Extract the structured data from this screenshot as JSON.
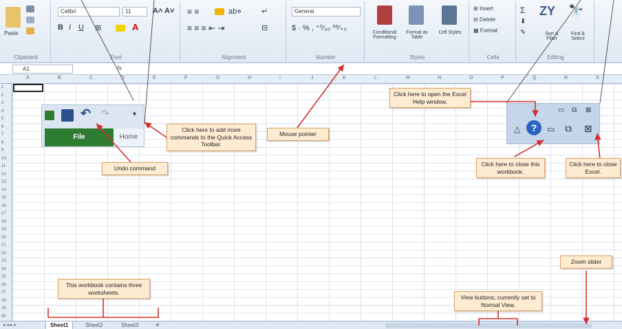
{
  "ribbon": {
    "clipboard": {
      "label": "Clipboard",
      "paste": "Paste"
    },
    "font": {
      "label": "Font",
      "font_name": "Calibri",
      "font_size": "11"
    },
    "alignment": {
      "label": "Alignment"
    },
    "number": {
      "label": "Number",
      "format": "General"
    },
    "styles": {
      "label": "Styles",
      "conditional": "Conditional Formatting",
      "format_table": "Format as Table",
      "cell_styles": "Cell Styles"
    },
    "cells": {
      "label": "Cells",
      "insert": "Insert",
      "delete": "Delete",
      "format": "Format"
    },
    "editing": {
      "label": "Editing",
      "sort": "Sort & Filter",
      "find": "Find & Select"
    }
  },
  "formula_bar": {
    "name_box": "A1",
    "fx": "fx"
  },
  "columns": [
    "A",
    "B",
    "C",
    "D",
    "E",
    "F",
    "G",
    "H",
    "I",
    "J",
    "K",
    "L",
    "M",
    "N",
    "O",
    "P",
    "Q",
    "R",
    "S"
  ],
  "rows": [
    "1",
    "2",
    "3",
    "4",
    "5",
    "6",
    "7",
    "8",
    "9",
    "10",
    "11",
    "12",
    "13",
    "14",
    "15",
    "16",
    "17",
    "18",
    "19",
    "20",
    "21",
    "22",
    "23",
    "24",
    "25",
    "26",
    "27",
    "28",
    "29",
    "30"
  ],
  "qat": {
    "file": "File",
    "home": "Home"
  },
  "sheets": [
    "Sheet1",
    "Sheet2",
    "Sheet3"
  ],
  "callouts": {
    "help": "Click here to open the Excel Help window.",
    "qat_add": "Click here to add more commands to the Quick Access Toolbar.",
    "mouse": "Mouse pointer",
    "undo": "Undo command",
    "close_workbook": "Click here to close this workbook.",
    "close_excel": "Click here to close Excel.",
    "zoom": "Zoom slider",
    "view": "View buttons; currently set to Normal View.",
    "worksheets": "This workbook contains three worksheets."
  },
  "colors": {
    "callout_bg": "#fdebd2",
    "arrow": "#d32f2f",
    "file_tab": "#2e7d32"
  }
}
